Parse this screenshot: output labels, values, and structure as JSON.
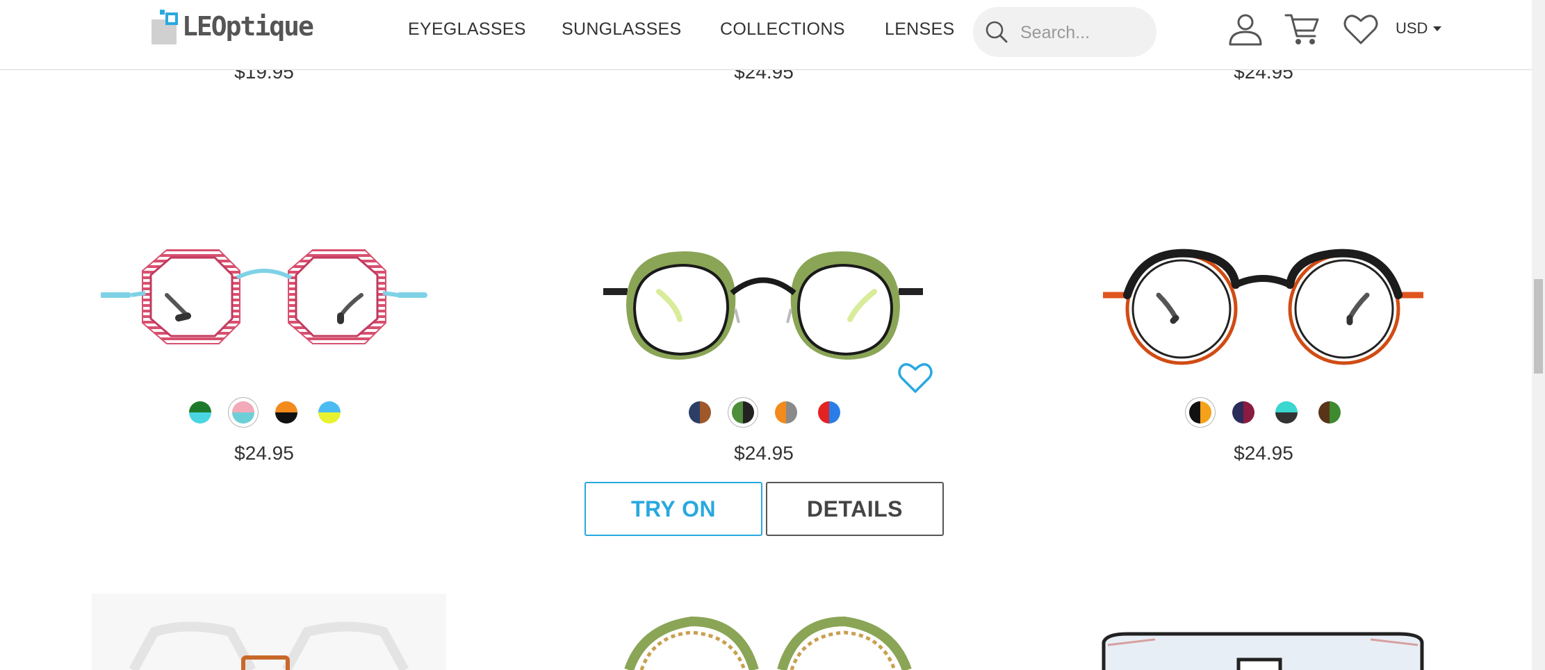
{
  "header": {
    "logo_text": "LEOptique",
    "nav": [
      {
        "label": "EYEGLASSES"
      },
      {
        "label": "SUNGLASSES"
      },
      {
        "label": "COLLECTIONS"
      },
      {
        "label": "LENSES"
      }
    ],
    "search_placeholder": "Search...",
    "currency": "USD",
    "icons": [
      "search-icon",
      "user-icon",
      "cart-icon",
      "heart-icon",
      "caret-down-icon"
    ]
  },
  "top_row": {
    "prices": [
      "$19.95",
      "$24.95",
      "$24.95"
    ]
  },
  "products": [
    {
      "price": "$24.95",
      "frame": "pink striped octagonal with light blue temples",
      "swatches": [
        {
          "top": "#1e7a2a",
          "bottom": "#4ad6e0",
          "selected": false
        },
        {
          "top": "#f2aab8",
          "bottom": "#6ccfd8",
          "selected": true
        },
        {
          "top": "#f28a1c",
          "bottom": "#111111",
          "selected": false
        },
        {
          "top": "#4bbcf2",
          "bottom": "#e8f230",
          "selected": false
        }
      ]
    },
    {
      "price": "$24.95",
      "frame": "olive green round with black wire",
      "swatches": [
        {
          "top": "#2c3e66",
          "bottom": "#a0572a",
          "split": "vertical",
          "selected": false
        },
        {
          "top": "#222222",
          "bottom": "#4e8d3a",
          "split": "vertical",
          "selected": true
        },
        {
          "top": "#f28a1c",
          "bottom": "#8a8a8a",
          "split": "vertical",
          "selected": false
        },
        {
          "top": "#e32222",
          "bottom": "#2a7de8",
          "split": "vertical",
          "selected": false
        }
      ],
      "actions": {
        "try_on": "TRY ON",
        "details": "DETAILS"
      }
    },
    {
      "price": "$24.95",
      "frame": "orange round with black brow",
      "swatches": [
        {
          "top": "#111111",
          "bottom": "#f5a21a",
          "split": "vertical",
          "selected": true
        },
        {
          "top": "#2c2c5a",
          "bottom": "#8a1c40",
          "split": "vertical",
          "selected": false
        },
        {
          "top": "#3ad6d0",
          "bottom": "#333333",
          "selected": false
        },
        {
          "top": "#5a3418",
          "bottom": "#3e8a2e",
          "split": "vertical",
          "selected": false
        }
      ]
    }
  ],
  "colors": {
    "accent": "#29a8e0",
    "text": "#333333"
  }
}
